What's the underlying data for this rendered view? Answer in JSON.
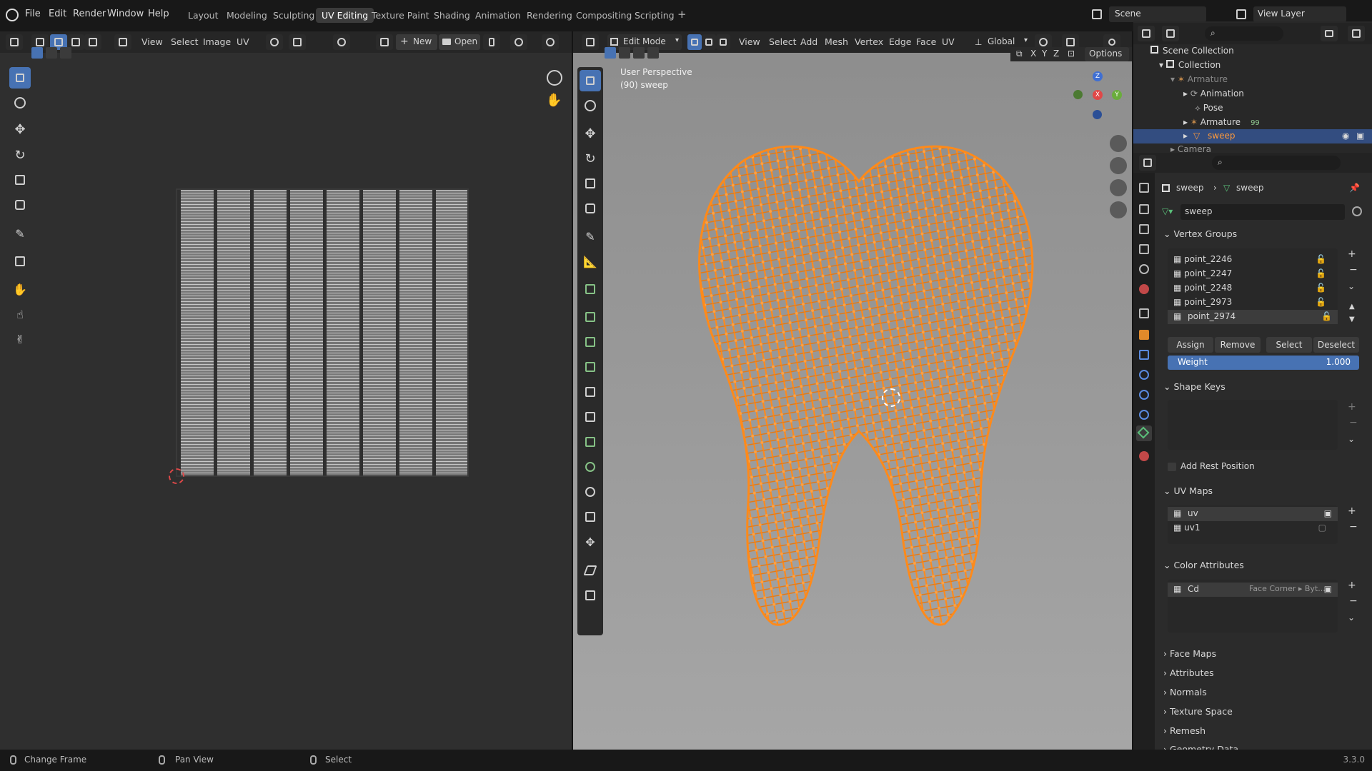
{
  "top_menu": [
    "File",
    "Edit",
    "Render",
    "Window",
    "Help"
  ],
  "workspaces": [
    "Layout",
    "Modeling",
    "Sculpting",
    "UV Editing",
    "Texture Paint",
    "Shading",
    "Animation",
    "Rendering",
    "Compositing",
    "Scripting"
  ],
  "add_workspace": "+",
  "scene": {
    "label": "Scene"
  },
  "view_layer": {
    "label": "View Layer"
  },
  "uv_header": {
    "menus": [
      "View",
      "Select",
      "Image",
      "UV"
    ],
    "new_label": "New",
    "open_label": "Open"
  },
  "viewport_header": {
    "mode": "Edit Mode",
    "menus": [
      "View",
      "Select",
      "Add",
      "Mesh",
      "Vertex",
      "Edge",
      "Face",
      "UV"
    ],
    "orientation": "Global",
    "axes": [
      "X",
      "Y",
      "Z"
    ],
    "options": "Options"
  },
  "viewport": {
    "perspective": "User Perspective",
    "object": "(90) sweep",
    "gizmo": {
      "z": "Z",
      "x": "X",
      "y": "Y"
    }
  },
  "outliner": {
    "items": [
      {
        "label": "Scene Collection"
      },
      {
        "label": "Collection"
      },
      {
        "label": "Armature"
      },
      {
        "label": "Animation"
      },
      {
        "label": "Pose"
      },
      {
        "label": "Armature",
        "badge": "99"
      },
      {
        "label": "sweep"
      },
      {
        "label": "Camera"
      }
    ]
  },
  "properties": {
    "breadcrumb": [
      "sweep",
      "sweep"
    ],
    "mesh_name": "sweep",
    "vertex_groups": {
      "title": "Vertex Groups",
      "items": [
        "point_2246",
        "point_2247",
        "point_2248",
        "point_2973",
        "point_2974"
      ],
      "buttons": [
        "Assign",
        "Remove",
        "Select",
        "Deselect"
      ],
      "weight_label": "Weight",
      "weight_value": "1.000"
    },
    "shape_keys": {
      "title": "Shape Keys"
    },
    "add_rest_position": "Add Rest Position",
    "uv_maps": {
      "title": "UV Maps",
      "items": [
        "uv",
        "uv1"
      ]
    },
    "color_attributes": {
      "title": "Color Attributes",
      "items": [
        {
          "name": "Cd",
          "domain": "Face Corner ▸ Byt..."
        }
      ]
    },
    "collapsed_sections": [
      "Face Maps",
      "Attributes",
      "Normals",
      "Texture Space",
      "Remesh",
      "Geometry Data"
    ]
  },
  "status_bar": {
    "items": [
      "Change Frame",
      "Pan View",
      "Select"
    ],
    "version": "3.3.0"
  },
  "colors": {
    "accent": "#4772b3",
    "mesh": "#ff8a1a",
    "header": "#232323"
  }
}
